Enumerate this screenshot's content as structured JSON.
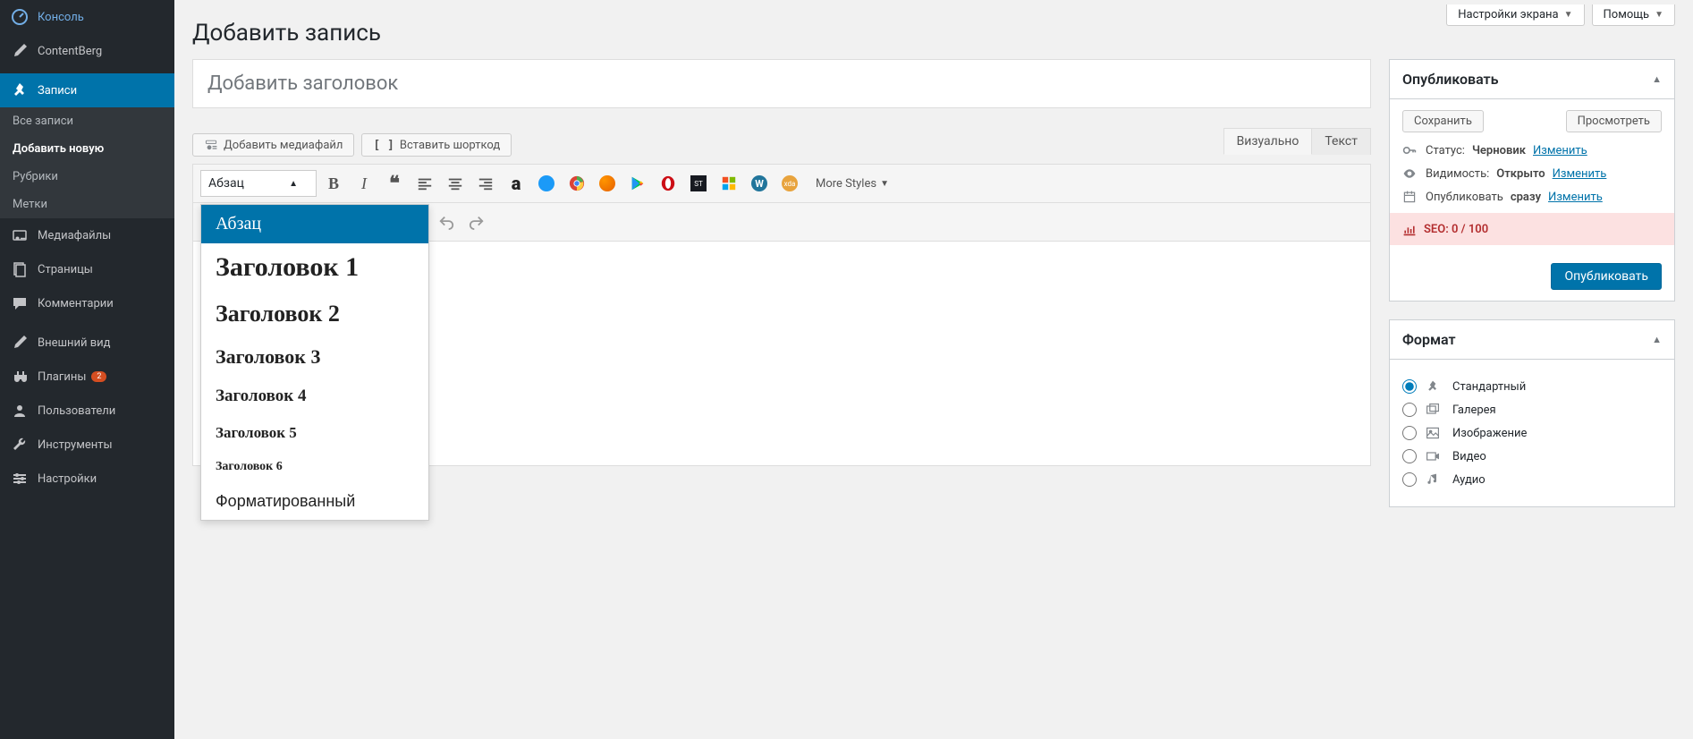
{
  "screen_tabs": {
    "screen_options": "Настройки экрана",
    "help": "Помощь"
  },
  "sidebar": {
    "items": [
      {
        "label": "Консоль"
      },
      {
        "label": "ContentBerg"
      },
      {
        "label": "Записи"
      },
      {
        "label": "Медиафайлы"
      },
      {
        "label": "Страницы"
      },
      {
        "label": "Комментарии"
      },
      {
        "label": "Внешний вид"
      },
      {
        "label": "Плагины"
      },
      {
        "label": "Пользователи"
      },
      {
        "label": "Инструменты"
      },
      {
        "label": "Настройки"
      }
    ],
    "posts_sub": [
      "Все записи",
      "Добавить новую",
      "Рубрики",
      "Метки"
    ],
    "plugin_badge": "2"
  },
  "page": {
    "title": "Добавить запись",
    "title_placeholder": "Добавить заголовок"
  },
  "media": {
    "add_media": "Добавить медиафайл",
    "insert_shortcode": "Вставить шорткод"
  },
  "editor": {
    "tabs": {
      "visual": "Визуально",
      "text": "Текст"
    },
    "format_selected": "Абзац",
    "more_styles": "More Styles",
    "dropdown": [
      "Абзац",
      "Заголовок 1",
      "Заголовок 2",
      "Заголовок 3",
      "Заголовок 4",
      "Заголовок 5",
      "Заголовок 6",
      "Форматированный"
    ]
  },
  "publish": {
    "heading": "Опубликовать",
    "save_draft": "Сохранить",
    "preview": "Просмотреть",
    "status_label": "Статус:",
    "status_value": "Черновик",
    "visibility_label": "Видимость:",
    "visibility_value": "Открыто",
    "schedule_label": "Опубликовать",
    "schedule_value": "сразу",
    "edit_link": "Изменить",
    "seo": "SEO: 0 / 100",
    "publish_btn": "Опубликовать"
  },
  "format_panel": {
    "heading": "Формат",
    "options": [
      "Стандартный",
      "Галерея",
      "Изображение",
      "Видео",
      "Аудио"
    ]
  }
}
